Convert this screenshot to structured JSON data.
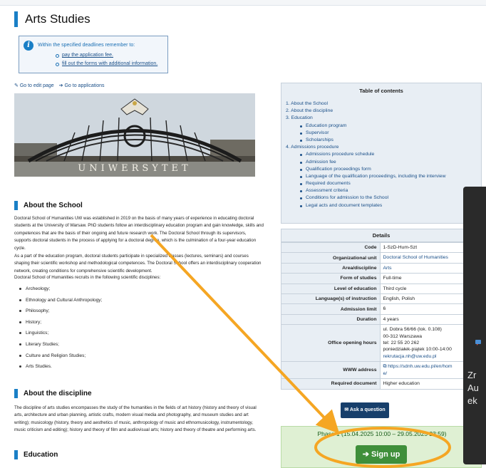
{
  "page": {
    "title": "Arts Studies"
  },
  "notice": {
    "heading": "Within the specified deadlines remember to:",
    "items": [
      "pay the application fee.",
      "fill out the forms with additional information."
    ]
  },
  "actions": {
    "edit": "Go to edit page",
    "applications": "Go to applications"
  },
  "hero": {
    "inscription": "UNIWERSYTET"
  },
  "about_school": {
    "heading": "About the School",
    "p1": "Doctoral School of Humanities UW was established in 2019 on the basis of many years of experience in educating doctoral students at the University of Warsaw. PhD students follow an interdisciplinary education program and gain knowledge, skills and competences that are the basis of their ongoing and future research work. The Doctoral School through its supervisors, supports doctoral students in the process of applying for a doctoral degree, which is the culmination of a four-year education cycle.",
    "p2": "As a part of the education program, doctoral students participate in specialized classes (lectures, seminars) and courses shaping their scientific workshop and methodological competences. The Doctoral School offers an interdisciplinary cooperation network, creating conditions for comprehensive scientific development.",
    "p3": "Doctoral School of Humanities recruits in the following scientific disciplines:",
    "disciplines": [
      "Archeology;",
      "Ethnology and Cultural Anthropology;",
      "Philosophy;",
      "History;",
      "Linguistics;",
      "Literary Studies;",
      "Culture and Religion Studies;",
      "Arts Studies."
    ]
  },
  "about_discipline": {
    "heading": "About the discipline",
    "p1": "The discipline of arts studies encompasses the study of the humanities in the fields of art history (history and theory of visual arts, architecture and urban planning, artistic crafts, modern visual media and photography, and museum studies and art writing); musicology (history, theory and aesthetics of music, anthropology of music and ethnomusicology, instrumentology, music criticism and editing); history and theory of film and audiovisual arts; history and theory of theatre and performing arts."
  },
  "education": {
    "heading": "Education"
  },
  "toc": {
    "title": "Table of contents",
    "items": [
      {
        "label": "1. About the School",
        "sub": false
      },
      {
        "label": "2. About the discipline",
        "sub": false
      },
      {
        "label": "3. Education",
        "sub": false
      },
      {
        "label": "Education program",
        "sub": true
      },
      {
        "label": "Supervisor",
        "sub": true
      },
      {
        "label": "Scholarships",
        "sub": true
      },
      {
        "label": "4. Admissions procedure",
        "sub": false
      },
      {
        "label": "Admissions procedure schedule",
        "sub": true
      },
      {
        "label": "Admission fee",
        "sub": true
      },
      {
        "label": "Qualification proceedings form",
        "sub": true
      },
      {
        "label": "Language of the qualification proceedings, including the interview",
        "sub": true
      },
      {
        "label": "Required documents",
        "sub": true
      },
      {
        "label": "Assessment criteria",
        "sub": true
      },
      {
        "label": "Conditions for admission to the School",
        "sub": true
      },
      {
        "label": "Legal acts and document templates",
        "sub": true
      }
    ]
  },
  "details": {
    "title": "Details",
    "code_k": "Code",
    "code_v": "1-SzD-Hum-Szt",
    "unit_k": "Organizational unit",
    "unit_v": "Doctoral School of Humanities",
    "area_k": "Area/discipline",
    "area_v": "Arts",
    "form_k": "Form of studies",
    "form_v": "Full-time",
    "level_k": "Level of education",
    "level_v": "Third cycle",
    "lang_k": "Language(s) of instruction",
    "lang_v": "English, Polish",
    "limit_k": "Admission limit",
    "limit_v": "6",
    "dur_k": "Duration",
    "dur_v": "4 years",
    "office_k": "Office opening hours",
    "office_l1": "ul. Dobra 56/66 (lok. 0.108)",
    "office_l2": "00-312 Warszawa",
    "office_l3": "tel: 22 55 20 262",
    "office_l4": "poniedziałek-piątek 10:00-14:00",
    "office_l5": "rekrutacja.nh@uw.edu.pl",
    "www_k": "WWW address",
    "www_v1": "https://sdnh.uw.edu.pl/en/hom",
    "www_v2": "e/",
    "doc_k": "Required document",
    "doc_v": "Higher education"
  },
  "ask_button": "Ask a question",
  "signup": {
    "phase": "Phase 1 (15.04.2025 10:00 – 29.05.2025 23:59)",
    "button": "Sign up"
  },
  "popup": {
    "line1": "Zr",
    "line2": "Au",
    "line3": "ek"
  },
  "colors": {
    "accent": "#1a7fc6",
    "link": "#1a4f88",
    "signup_green": "#3f8f3a",
    "annotation": "#f5a623"
  }
}
